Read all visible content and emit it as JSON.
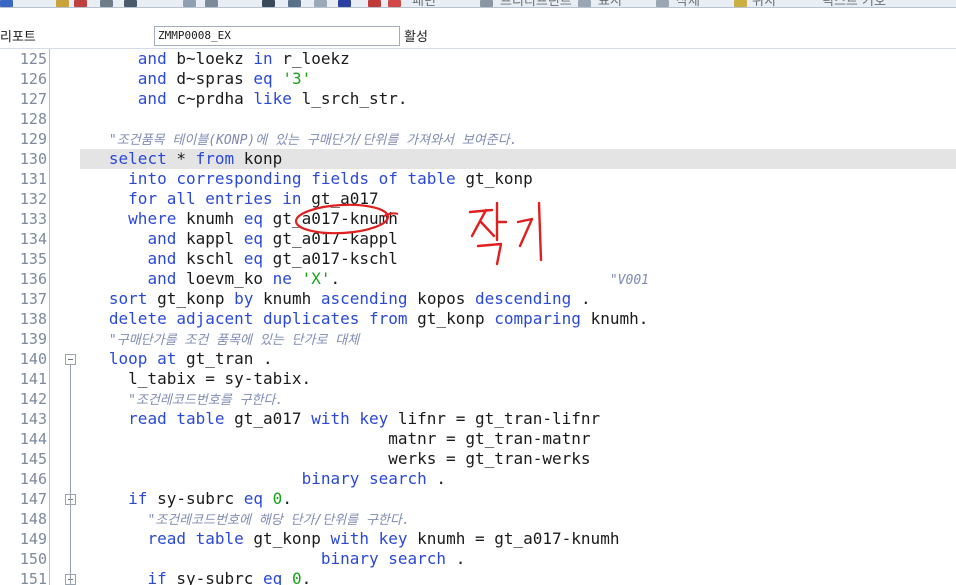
{
  "toolbar": {
    "labels": [
      "패턴",
      "프리티프린트",
      "표시",
      "삭제",
      "위치",
      "릭스트 기호"
    ]
  },
  "header": {
    "label": "리포트",
    "program": "ZMMP0008_EX",
    "status": "활성"
  },
  "editor": {
    "current_line": 130,
    "lines": [
      {
        "n": "125",
        "tokens": [
          {
            "t": "      "
          },
          {
            "t": "and",
            "c": "kw"
          },
          {
            "t": " b~loekz "
          },
          {
            "t": "in",
            "c": "kw"
          },
          {
            "t": " r_loekz"
          }
        ]
      },
      {
        "n": "126",
        "tokens": [
          {
            "t": "      "
          },
          {
            "t": "and",
            "c": "kw"
          },
          {
            "t": " d~spras "
          },
          {
            "t": "eq",
            "c": "kw"
          },
          {
            "t": " "
          },
          {
            "t": "'3'",
            "c": "str"
          }
        ]
      },
      {
        "n": "127",
        "tokens": [
          {
            "t": "      "
          },
          {
            "t": "and",
            "c": "kw"
          },
          {
            "t": " c~prdha "
          },
          {
            "t": "like",
            "c": "kw"
          },
          {
            "t": " l_srch_str."
          }
        ]
      },
      {
        "n": "128",
        "tokens": []
      },
      {
        "n": "129",
        "tokens": [
          {
            "t": "   "
          },
          {
            "t": "\"조건품목 테이블(KONP)에 있는 구매단가/단위를 가져와서 보여준다.",
            "c": "cmt"
          }
        ]
      },
      {
        "n": "130",
        "tokens": [
          {
            "t": "   "
          },
          {
            "t": "select",
            "c": "kw"
          },
          {
            "t": " * "
          },
          {
            "t": "from",
            "c": "kw"
          },
          {
            "t": " konp"
          }
        ]
      },
      {
        "n": "131",
        "tokens": [
          {
            "t": "     "
          },
          {
            "t": "into corresponding fields of table",
            "c": "kw"
          },
          {
            "t": " gt_konp"
          }
        ]
      },
      {
        "n": "132",
        "tokens": [
          {
            "t": "     "
          },
          {
            "t": "for all entries in",
            "c": "kw"
          },
          {
            "t": " gt_a017"
          }
        ]
      },
      {
        "n": "133",
        "tokens": [
          {
            "t": "     "
          },
          {
            "t": "where",
            "c": "kw"
          },
          {
            "t": " knumh "
          },
          {
            "t": "eq",
            "c": "kw"
          },
          {
            "t": " gt_a017-knumh"
          }
        ]
      },
      {
        "n": "134",
        "tokens": [
          {
            "t": "       "
          },
          {
            "t": "and",
            "c": "kw"
          },
          {
            "t": " kappl "
          },
          {
            "t": "eq",
            "c": "kw"
          },
          {
            "t": " gt_a017-kappl"
          }
        ]
      },
      {
        "n": "135",
        "tokens": [
          {
            "t": "       "
          },
          {
            "t": "and",
            "c": "kw"
          },
          {
            "t": " kschl "
          },
          {
            "t": "eq",
            "c": "kw"
          },
          {
            "t": " gt_a017-kschl"
          }
        ]
      },
      {
        "n": "136",
        "tokens": [
          {
            "t": "       "
          },
          {
            "t": "and",
            "c": "kw"
          },
          {
            "t": " loevm_ko "
          },
          {
            "t": "ne",
            "c": "kw"
          },
          {
            "t": " "
          },
          {
            "t": "'X'",
            "c": "str"
          },
          {
            "t": ".                            "
          },
          {
            "t": "\"V001",
            "c": "cmt"
          }
        ]
      },
      {
        "n": "137",
        "tokens": [
          {
            "t": "   "
          },
          {
            "t": "sort",
            "c": "kw"
          },
          {
            "t": " gt_konp "
          },
          {
            "t": "by",
            "c": "kw"
          },
          {
            "t": " knumh "
          },
          {
            "t": "ascending",
            "c": "kw"
          },
          {
            "t": " kopos "
          },
          {
            "t": "descending",
            "c": "kw"
          },
          {
            "t": " ."
          }
        ]
      },
      {
        "n": "138",
        "tokens": [
          {
            "t": "   "
          },
          {
            "t": "delete adjacent duplicates from",
            "c": "kw"
          },
          {
            "t": " gt_konp "
          },
          {
            "t": "comparing",
            "c": "kw"
          },
          {
            "t": " knumh."
          }
        ]
      },
      {
        "n": "139",
        "tokens": [
          {
            "t": "   "
          },
          {
            "t": "\"구매단가를 조건 품목에 있는 단가로 대체",
            "c": "cmt"
          }
        ]
      },
      {
        "n": "140",
        "fold": true,
        "tokens": [
          {
            "t": "   "
          },
          {
            "t": "loop at",
            "c": "kw"
          },
          {
            "t": " gt_tran ."
          }
        ]
      },
      {
        "n": "141",
        "tokens": [
          {
            "t": "     l_tabix = sy-tabix."
          }
        ]
      },
      {
        "n": "142",
        "tokens": [
          {
            "t": "     "
          },
          {
            "t": "\"조건레코드번호를 구한다.",
            "c": "cmt"
          }
        ]
      },
      {
        "n": "143",
        "tokens": [
          {
            "t": "     "
          },
          {
            "t": "read table",
            "c": "kw"
          },
          {
            "t": " gt_a017 "
          },
          {
            "t": "with key",
            "c": "kw"
          },
          {
            "t": " lifnr = gt_tran-lifnr"
          }
        ]
      },
      {
        "n": "144",
        "tokens": [
          {
            "t": "                                matnr = gt_tran-matnr"
          }
        ]
      },
      {
        "n": "145",
        "tokens": [
          {
            "t": "                                werks = gt_tran-werks"
          }
        ]
      },
      {
        "n": "146",
        "tokens": [
          {
            "t": "                       "
          },
          {
            "t": "binary search",
            "c": "kw"
          },
          {
            "t": " ."
          }
        ]
      },
      {
        "n": "147",
        "fold": true,
        "tokens": [
          {
            "t": "     "
          },
          {
            "t": "if",
            "c": "kw"
          },
          {
            "t": " sy-subrc "
          },
          {
            "t": "eq",
            "c": "kw"
          },
          {
            "t": " "
          },
          {
            "t": "0",
            "c": "str"
          },
          {
            "t": "."
          }
        ]
      },
      {
        "n": "148",
        "tokens": [
          {
            "t": "       "
          },
          {
            "t": "\"조건레코드번호에 해당 단가/단위를 구한다.",
            "c": "cmt"
          }
        ]
      },
      {
        "n": "149",
        "tokens": [
          {
            "t": "       "
          },
          {
            "t": "read table",
            "c": "kw"
          },
          {
            "t": " gt_konp "
          },
          {
            "t": "with key",
            "c": "kw"
          },
          {
            "t": " knumh = gt_a017-knumh"
          }
        ]
      },
      {
        "n": "150",
        "tokens": [
          {
            "t": "                         "
          },
          {
            "t": "binary search",
            "c": "kw"
          },
          {
            "t": " ."
          }
        ]
      },
      {
        "n": "151",
        "fold": true,
        "tokens": [
          {
            "t": "       "
          },
          {
            "t": "if",
            "c": "kw"
          },
          {
            "t": " sy-subrc "
          },
          {
            "t": "eq",
            "c": "kw"
          },
          {
            "t": " "
          },
          {
            "t": "0",
            "c": "str"
          },
          {
            "t": "."
          }
        ]
      }
    ]
  },
  "annotation": {
    "handwritten_text": "찾기",
    "color": "#e02020"
  },
  "colors": {
    "keyword": "#2a49d6",
    "string": "#19a119",
    "comment": "#7f8bb3",
    "line_number": "#7d8a9c",
    "current_line_bg": "#e4e4e4"
  }
}
